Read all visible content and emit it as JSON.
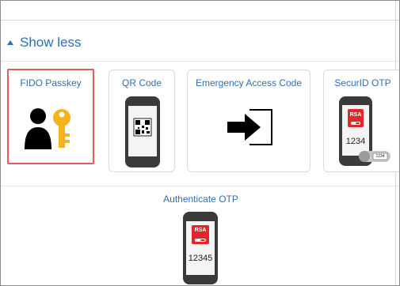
{
  "toggle": {
    "label": "Show less",
    "icon": "caret-up-icon"
  },
  "methods": [
    {
      "label": "FIDO Passkey",
      "icon": "user-key-icon",
      "selected": true
    },
    {
      "label": "QR Code",
      "icon": "phone-qr-icon"
    },
    {
      "label": "Emergency Access Code",
      "icon": "arrow-into-box-icon"
    },
    {
      "label": "SecurID OTP",
      "icon": "phone-rsa-token-icon",
      "code": "1234",
      "token_code": "1234",
      "brand": "RSA"
    }
  ],
  "authenticate": {
    "label": "Authenticate OTP",
    "brand": "RSA",
    "code": "12345"
  },
  "colors": {
    "link": "#2f6fb3",
    "selected_border": "#e35b5b",
    "rsa_red": "#e3262d",
    "key_gold": "#f2b31b"
  }
}
